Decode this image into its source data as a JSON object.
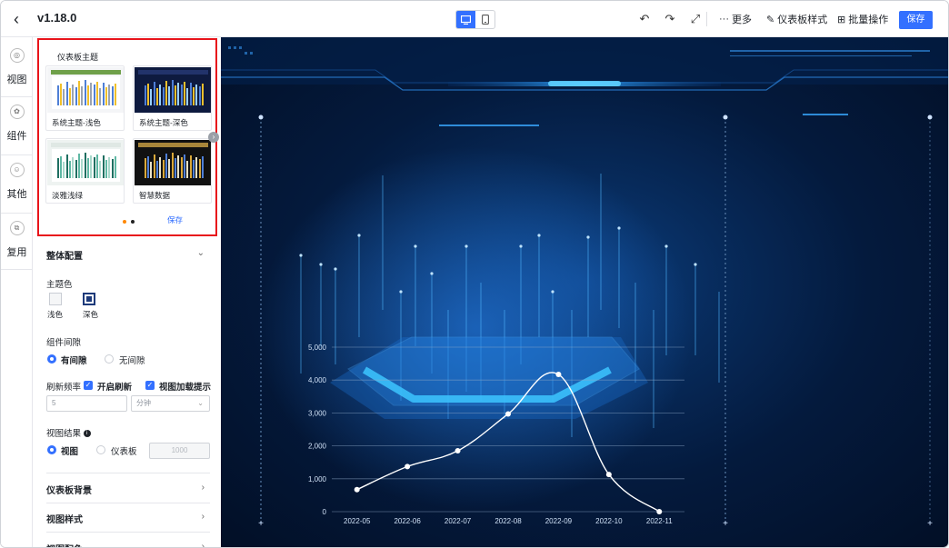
{
  "header": {
    "version": "v1.18.0",
    "more_label": "更多",
    "dashboard_style_label": "仪表板样式",
    "batch_label": "批量操作",
    "save_label": "保存"
  },
  "rail": {
    "items": [
      {
        "label": "视图"
      },
      {
        "label": "组件"
      },
      {
        "label": "其他"
      },
      {
        "label": "复用"
      }
    ]
  },
  "theme_panel": {
    "title": "仪表板主题",
    "themes": [
      {
        "name": "系统主题-浅色"
      },
      {
        "name": "系统主题-深色"
      },
      {
        "name": "淡雅浅绿"
      },
      {
        "name": "智慧数据"
      }
    ],
    "save_label": "保存"
  },
  "overall": {
    "title": "整体配置",
    "theme_color_label": "主题色",
    "light_label": "浅色",
    "dark_label": "深色",
    "gap_label": "组件间隙",
    "gap_on_label": "有间隙",
    "gap_off_label": "无间隙",
    "refresh_label": "刷新频率",
    "enable_refresh_label": "开启刷新",
    "load_tip_label": "视图加载提示",
    "refresh_value": "5",
    "refresh_unit": "分钟",
    "result_label": "视图结果",
    "result_view_label": "视图",
    "result_dashboard_label": "仪表板",
    "result_count": "1000"
  },
  "sections": {
    "background": "仪表板背景",
    "view_style": "视图样式",
    "view_color": "视图配色"
  },
  "colors": {
    "accent": "#3370ff",
    "highlight_border": "#e8141b"
  },
  "chart_data": {
    "type": "line",
    "categories": [
      "2022-05",
      "2022-06",
      "2022-07",
      "2022-08",
      "2022-09",
      "2022-10",
      "2022-11"
    ],
    "values": [
      670,
      1370,
      1850,
      2970,
      4170,
      1130,
      0
    ],
    "ylim": [
      0,
      5000
    ],
    "yticks": [
      0,
      1000,
      2000,
      3000,
      4000,
      5000
    ],
    "ytick_labels": [
      "0",
      "1,000",
      "2,000",
      "3,000",
      "4,000",
      "5,000"
    ],
    "grid": true,
    "line_color": "#ffffff"
  }
}
